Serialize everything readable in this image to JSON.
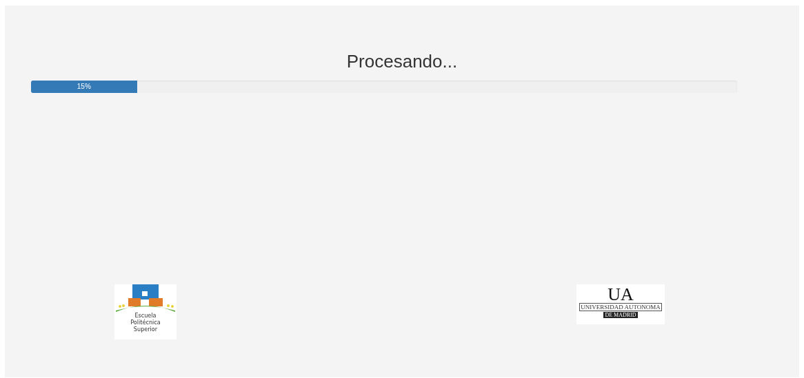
{
  "title": "Procesando...",
  "progress": {
    "level": 0.15,
    "label": "15%"
  },
  "logos": [
    {
      "kind": "eps",
      "lines": [
        "Escuela",
        "Politécnica",
        "Superior"
      ]
    },
    {
      "kind": "uam",
      "mark": "UA",
      "name": "UNIVERSIDAD AUTONOMA",
      "place": "DE MADRID"
    }
  ]
}
